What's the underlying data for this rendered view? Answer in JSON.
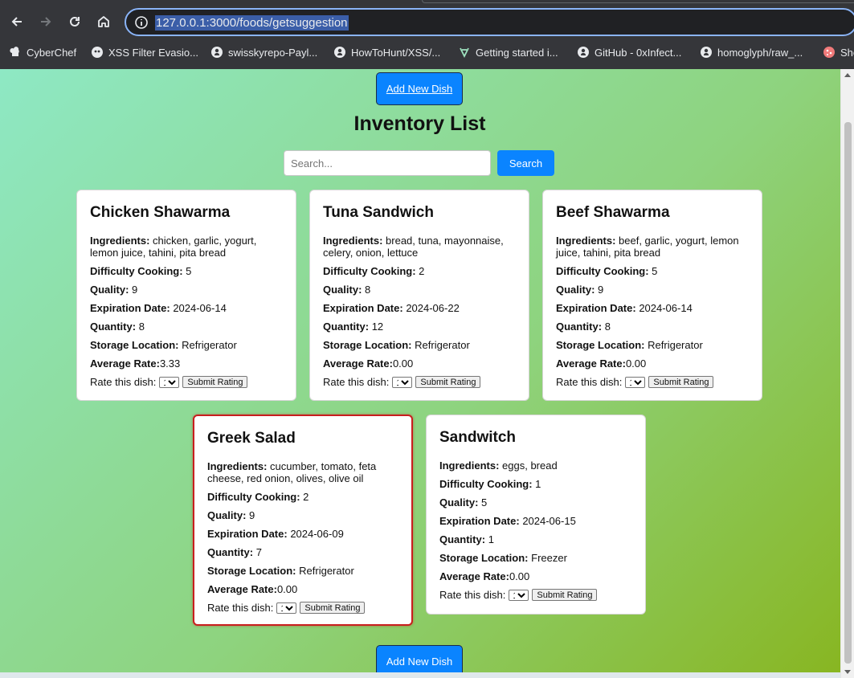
{
  "browser": {
    "url": "127.0.0.1:3000/foods/getsuggestion",
    "bookmarks": [
      {
        "label": "CyberChef",
        "icon": "chef-hat-icon"
      },
      {
        "label": "XSS Filter Evasio...",
        "icon": "owasp-icon"
      },
      {
        "label": "swisskyrepo-Payl...",
        "icon": "github-icon"
      },
      {
        "label": "HowToHunt/XSS/...",
        "icon": "github-icon"
      },
      {
        "label": "Getting started i...",
        "icon": "feather-icon"
      },
      {
        "label": "GitHub - 0xInfect...",
        "icon": "github-icon"
      },
      {
        "label": "homoglyph/raw_...",
        "icon": "github-icon"
      },
      {
        "label": "She",
        "icon": "cookie-icon"
      }
    ]
  },
  "page": {
    "add_button_label": "Add New Dish",
    "title": "Inventory List",
    "search_placeholder": "Search...",
    "search_button_label": "Search",
    "labels": {
      "ingredients": "Ingredients:",
      "difficulty": "Difficulty Cooking:",
      "quality": "Quality:",
      "expiration": "Expiration Date:",
      "quantity": "Quantity:",
      "storage": "Storage Location:",
      "average": "Average Rate:",
      "rate": "Rate this dish:",
      "submit": "Submit Rating"
    },
    "dishes": [
      {
        "name": "Chicken Shawarma",
        "ingredients": "chicken, garlic, yogurt, lemon juice, tahini, pita bread",
        "difficulty": "5",
        "quality": "9",
        "expiration": "2024-06-14",
        "quantity": "8",
        "storage": "Refrigerator",
        "average": "3.33",
        "rating": "1",
        "highlighted": false
      },
      {
        "name": "Tuna Sandwich",
        "ingredients": "bread, tuna, mayonnaise, celery, onion, lettuce",
        "difficulty": "2",
        "quality": "8",
        "expiration": "2024-06-22",
        "quantity": "12",
        "storage": "Refrigerator",
        "average": "0.00",
        "rating": "1",
        "highlighted": false
      },
      {
        "name": "Beef Shawarma",
        "ingredients": "beef, garlic, yogurt, lemon juice, tahini, pita bread",
        "difficulty": "5",
        "quality": "9",
        "expiration": "2024-06-14",
        "quantity": "8",
        "storage": "Refrigerator",
        "average": "0.00",
        "rating": "1",
        "highlighted": false
      },
      {
        "name": "Greek Salad",
        "ingredients": "cucumber, tomato, feta cheese, red onion, olives, olive oil",
        "difficulty": "2",
        "quality": "9",
        "expiration": "2024-06-09",
        "quantity": "7",
        "storage": "Refrigerator",
        "average": "0.00",
        "rating": "1",
        "highlighted": true
      },
      {
        "name": "Sandwitch",
        "ingredients": "eggs, bread",
        "difficulty": "1",
        "quality": "5",
        "expiration": "2024-06-15",
        "quantity": "1",
        "storage": "Freezer",
        "average": "0.00",
        "rating": "1",
        "highlighted": false
      }
    ]
  },
  "colors": {
    "accent_blue": "#0a84ff",
    "highlight_red": "#c81e1e"
  }
}
